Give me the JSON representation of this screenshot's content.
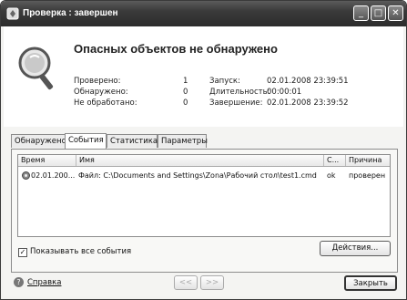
{
  "window": {
    "title": "Проверка : завершен",
    "controls": {
      "minimize": "_",
      "maximize": "□",
      "close": "✕"
    }
  },
  "summary": {
    "headline": "Опасных объектов не обнаружено",
    "left": [
      {
        "label": "Проверено:",
        "value": "1"
      },
      {
        "label": "Обнаружено:",
        "value": "0"
      },
      {
        "label": "Не обработано:",
        "value": "0"
      }
    ],
    "right": [
      {
        "label": "Запуск:",
        "value": "02.01.2008 23:39:51"
      },
      {
        "label": "Длительность:",
        "value": "00:00:01"
      },
      {
        "label": "Завершение:",
        "value": "02.01.2008 23:39:52"
      }
    ]
  },
  "tabs": [
    {
      "label": "Обнаружено",
      "active": false
    },
    {
      "label": "События",
      "active": true
    },
    {
      "label": "Статистика",
      "active": false
    },
    {
      "label": "Параметры",
      "active": false
    }
  ],
  "events_table": {
    "columns": [
      "Время",
      "Имя",
      "С...",
      "Причина"
    ],
    "rows": [
      {
        "time": "02.01.200...",
        "name": "Файл: C:\\Documents and Settings\\Zona\\Рабочий стол\\test1.cmd",
        "status": "ok",
        "reason": "проверен"
      }
    ]
  },
  "show_all_events": {
    "label": "Показывать все события",
    "checked": true
  },
  "buttons": {
    "actions": "Действия...",
    "prev": "<<",
    "next": ">>",
    "close": "Закрыть"
  },
  "help": {
    "label": "Справка"
  }
}
